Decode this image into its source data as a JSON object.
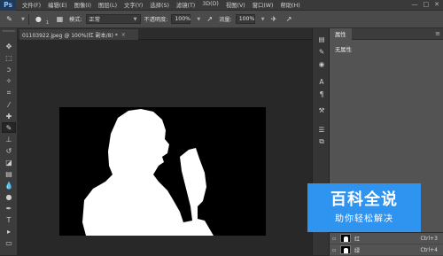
{
  "app": {
    "logo": "Ps"
  },
  "menu": [
    "文件(F)",
    "编辑(E)",
    "图像(I)",
    "图层(L)",
    "文字(Y)",
    "选择(S)",
    "滤镜(T)",
    "3D(D)",
    "视图(V)",
    "窗口(W)",
    "帮助(H)"
  ],
  "window_controls": {
    "minimize": "—",
    "maximize": "□",
    "close": "✕"
  },
  "options": {
    "brush_size": "1",
    "mode_label": "模式:",
    "mode_value": "正常",
    "opacity_label": "不透明度:",
    "opacity_value": "100%",
    "flow_label": "流量:",
    "flow_value": "100%"
  },
  "document": {
    "tab_title": "01103922.jpeg @ 100%(红 副本/8) *",
    "close": "×"
  },
  "properties": {
    "tab": "属性",
    "empty_text": "无属性",
    "menu_icon": "≡"
  },
  "layers": [
    {
      "name": "红",
      "shortcut": "Ctrl+3"
    },
    {
      "name": "绿",
      "shortcut": "Ctrl+4"
    }
  ],
  "watermark": {
    "title": "百科全说",
    "subtitle": "助你轻松解决"
  },
  "icons": {
    "tools": [
      "move-icon",
      "marquee-icon",
      "lasso-icon",
      "quick-select-icon",
      "crop-icon",
      "eyedropper-icon",
      "healing-icon",
      "brush-icon",
      "stamp-icon",
      "history-brush-icon",
      "eraser-icon",
      "gradient-icon",
      "blur-icon",
      "dodge-icon",
      "pen-icon",
      "type-icon",
      "path-select-icon",
      "shape-icon",
      "hand-icon",
      "zoom-icon"
    ]
  },
  "colors": {
    "accent": "#2f93f0",
    "panel": "#535353",
    "workspace": "#282828"
  }
}
